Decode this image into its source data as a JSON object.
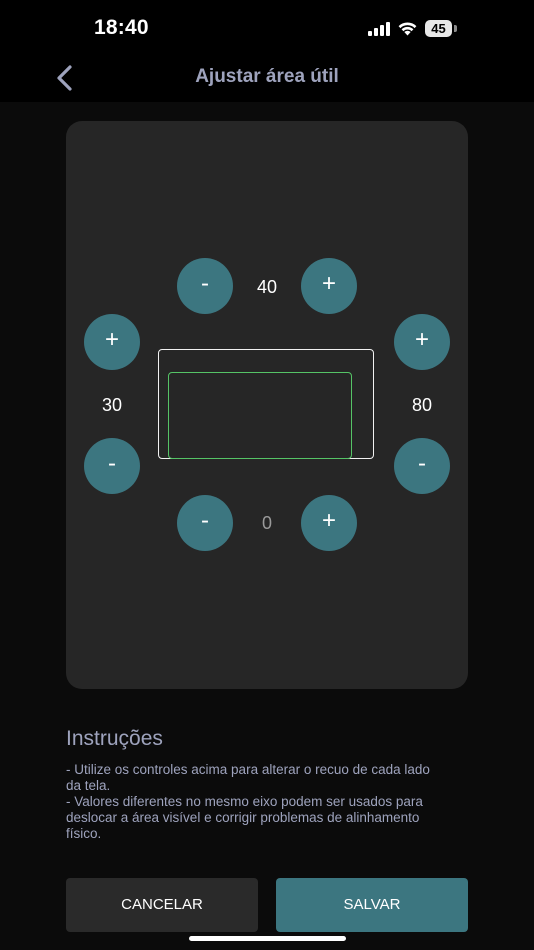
{
  "status_bar": {
    "time": "18:40",
    "battery": "45",
    "icons": [
      "signal-icon",
      "wifi-icon",
      "battery-icon"
    ]
  },
  "header": {
    "back_icon": "chevron-left-icon",
    "title": "Ajustar área útil"
  },
  "controls": {
    "top": {
      "value": "40",
      "minus_label": "-",
      "plus_label": "+"
    },
    "bottom": {
      "value": "0",
      "minus_label": "-",
      "plus_label": "+"
    },
    "left": {
      "value": "30",
      "minus_label": "-",
      "plus_label": "+"
    },
    "right": {
      "value": "80",
      "minus_label": "-",
      "plus_label": "+"
    }
  },
  "instructions": {
    "title": "Instruções",
    "lines": [
      "- Utilize os controles acima para alterar o recuo de cada lado da tela.",
      "- Valores diferentes no mesmo eixo podem ser usados para deslocar a área visível e corrigir problemas de alinhamento físico."
    ]
  },
  "actions": {
    "cancel_label": "CANCELAR",
    "save_label": "SALVAR"
  },
  "colors": {
    "accent": "#3c7680",
    "title_text": "#9ea3bd",
    "card_bg": "#262626",
    "safe_area_border": "#55c466"
  }
}
